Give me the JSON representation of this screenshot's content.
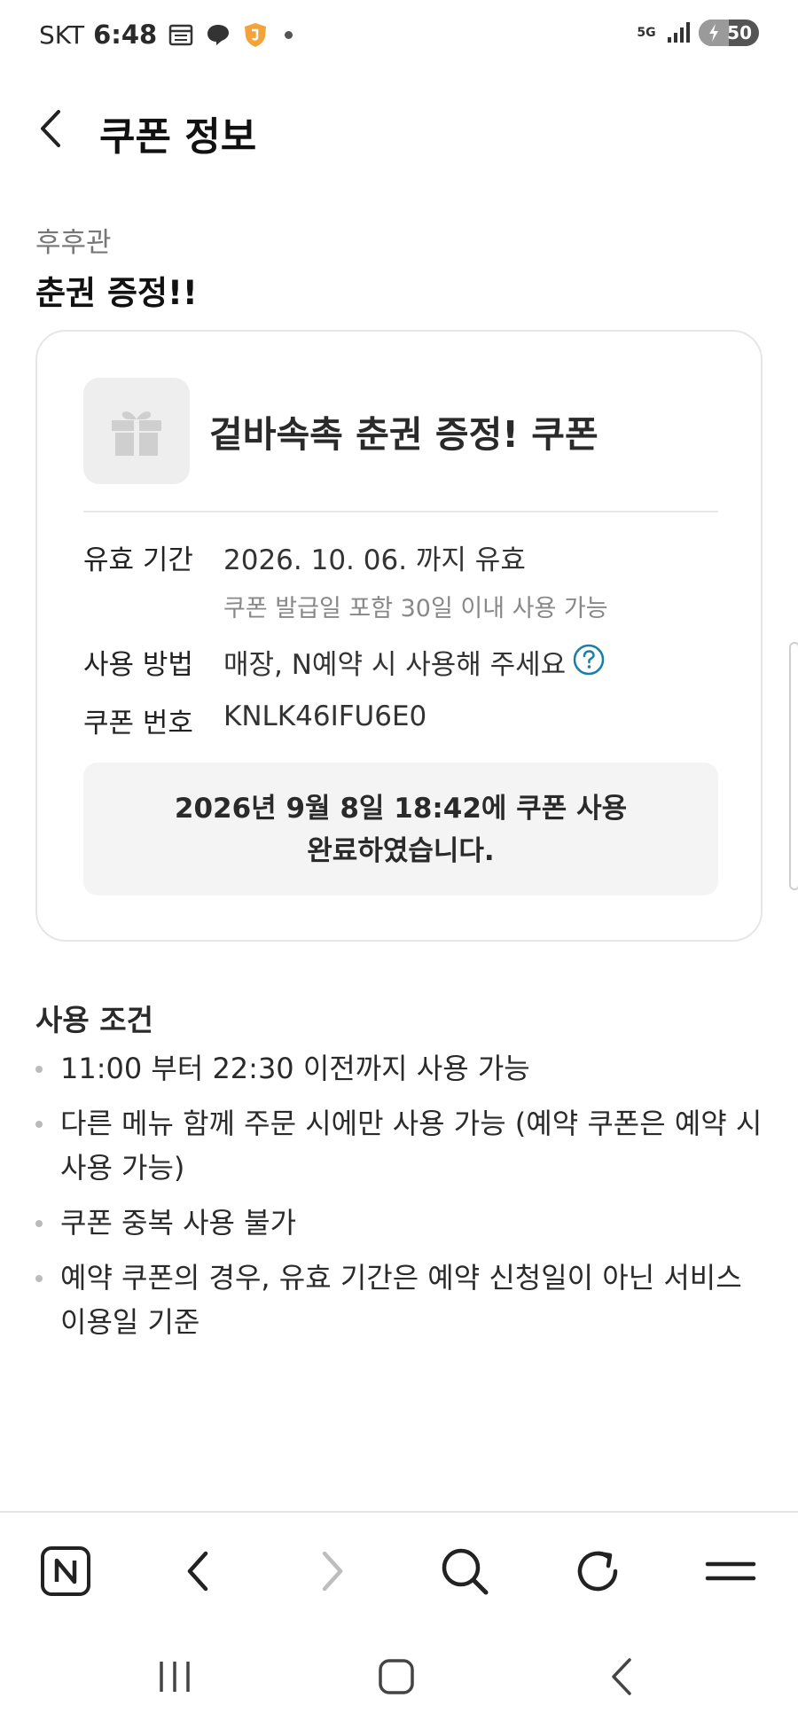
{
  "status_bar": {
    "carrier": "SKT",
    "time": "6:48",
    "network": "5G",
    "battery": "50",
    "battery_level": 0.5
  },
  "header": {
    "title": "쿠폰 정보"
  },
  "coupon": {
    "store": "후후관",
    "title": "춘권 증정!!",
    "name": "겉바속촉 춘권 증정! 쿠폰",
    "validity_label": "유효 기간",
    "validity_value": "2026. 10. 06. 까지 유효",
    "validity_note": "쿠폰 발급일 포함 30일 이내 사용 가능",
    "usage_label": "사용 방법",
    "usage_value": "매장, N예약 시 사용해 주세요",
    "number_label": "쿠폰 번호",
    "number_value": "KNLK46IFU6E0",
    "used_line1": "2026년 9월 8일 18:42에 쿠폰 사용",
    "used_line2": "완료하였습니다."
  },
  "conditions": {
    "title": "사용 조건",
    "items": [
      "11:00 부터 22:30 이전까지 사용 가능",
      "다른 메뉴 함께 주문 시에만 사용 가능 (예약 쿠폰은 예약 시 사용 가능)",
      "쿠폰 중복 사용 불가",
      "예약 쿠폰의 경우, 유효 기간은 예약 신청일이 아닌 서비스 이용일 기준"
    ]
  },
  "toolbar": {
    "items": [
      "naver-home-icon",
      "back-icon",
      "forward-icon",
      "search-icon",
      "refresh-icon",
      "menu-icon"
    ]
  },
  "colors": {
    "accent": "#1a7fa8",
    "text": "#111111",
    "muted": "#888888",
    "card_border": "#e6e6e6",
    "used_bg": "#f4f4f4"
  }
}
